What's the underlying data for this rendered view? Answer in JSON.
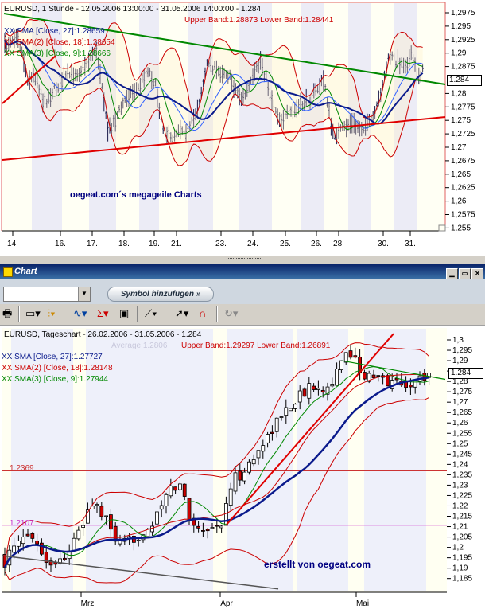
{
  "top_chart": {
    "title": "EURUSD, 1 Stunde - 12.05.2006 13:00:00 - 31.05.2006 14:00:00 - 1.284",
    "bands": "Upper Band:1.28873 Lower Band:1.28441",
    "legend": [
      "XX SMA [Close, 27]:1.28659",
      "XX SMA(2) [Close, 18]:1.28654",
      "XX SMA(3) [Close, 9]:1.28666"
    ],
    "watermark": "oegeat.com´s megageile Charts",
    "x_labels": [
      "14.",
      "16.",
      "17.",
      "18.",
      "19.",
      "21.",
      "23.",
      "24.",
      "25.",
      "26.",
      "28.",
      "30.",
      "31."
    ],
    "y_labels": [
      "1,2975",
      "1,295",
      "1,2925",
      "1,29",
      "1,2875",
      "1,2825",
      "1,28",
      "1,2775",
      "1,275",
      "1,2725",
      "1,27",
      "1,2675",
      "1,265",
      "1,2625",
      "1,26",
      "1,2575",
      "1,255"
    ],
    "last_price": "1.284"
  },
  "window": {
    "title": "Chart",
    "minimize_icon": "minimize-icon",
    "restore_icon": "restore-icon",
    "close_icon": "close-icon"
  },
  "symbolbar": {
    "symbol_value": "",
    "add_button": "Symbol hinzufügen »"
  },
  "toolbar": {
    "icons": [
      "printer-icon",
      "chart-window-icon",
      "chart-type-icon",
      "indicator-icon",
      "sigma-icon",
      "properties-icon",
      "draw-line-icon",
      "cursor-icon",
      "magnet-icon",
      "undo-icon"
    ]
  },
  "bottom_chart": {
    "title": "EURUSD, Tageschart - 26.02.2006 - 31.05.2006 - 1.284",
    "ghost_text": "Average 1.2806",
    "bands": "Upper Band:1.29297 Lower Band:1.26891",
    "legend": [
      "XX SMA [Close, 27]:1.27727",
      "XX SMA(2) [Close, 18]:1.28148",
      "XX SMA(3) [Close, 9]:1.27944"
    ],
    "level1": "1.2369",
    "level2": "1.2107",
    "watermark": "erstellt von oegeat.com",
    "x_labels": [
      "Mrz",
      "Apr",
      "Mai"
    ],
    "y_labels": [
      "1,3",
      "1,295",
      "1,29",
      "1,285",
      "1,28",
      "1,275",
      "1,27",
      "1,265",
      "1,26",
      "1,255",
      "1,25",
      "1,245",
      "1,24",
      "1,235",
      "1,23",
      "1,225",
      "1,22",
      "1,215",
      "1,21",
      "1,205",
      "1,2",
      "1,195",
      "1,19",
      "1,185"
    ],
    "last_price": "1.284"
  },
  "colors": {
    "sma27": "#0a1a8c",
    "sma18": "#cc0000",
    "sma9": "#008800",
    "band": "#cc0000",
    "trend_green": "#008800",
    "trend_red": "#e00000",
    "level1": "#cc3333",
    "level2": "#cc33cc"
  }
}
